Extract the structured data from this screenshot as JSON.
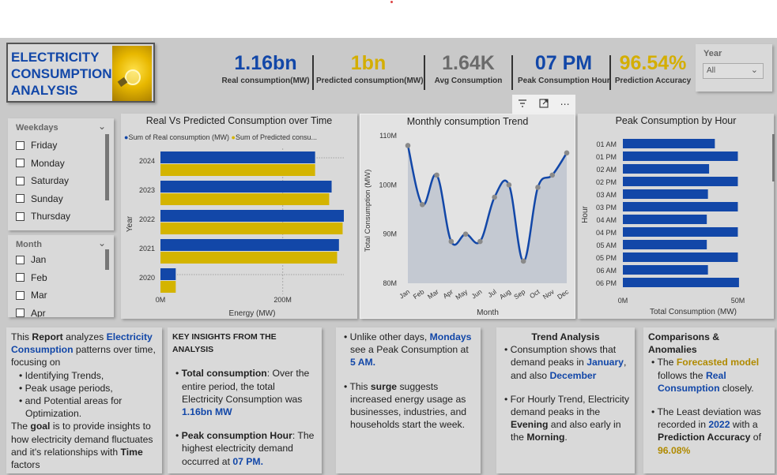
{
  "title": "ELECTRICITY CONSUMPTION ANALYSIS",
  "kpis": [
    {
      "value": "1.16bn",
      "label": "Real consumption(MW)",
      "color": "#1247a8"
    },
    {
      "value": "1bn",
      "label": "Predicted consumption(MW)",
      "color": "#d4ae00"
    },
    {
      "value": "1.64K",
      "label": "Avg Consumption",
      "color": "#6b6b6b"
    },
    {
      "value": "07 PM",
      "label": "Peak Consumption Hour",
      "color": "#1247a8"
    },
    {
      "value": "96.54%",
      "label": "Prediction Accuracy",
      "color": "#d4ae00"
    }
  ],
  "year_slicer": {
    "title": "Year",
    "value": "All"
  },
  "weekdays_slicer": {
    "title": "Weekdays",
    "items": [
      "Friday",
      "Monday",
      "Saturday",
      "Sunday",
      "Thursday"
    ]
  },
  "month_slicer": {
    "title": "Month",
    "items": [
      "Jan",
      "Feb",
      "Mar",
      "Apr"
    ]
  },
  "colors": {
    "real": "#1247a8",
    "predicted": "#d4b400",
    "area": "#c4c9d2"
  },
  "chart_data": [
    {
      "type": "bar",
      "title": "Real Vs Predicted Consumption over Time",
      "legend": [
        "Sum of Real consumption (MW)",
        "Sum of Predicted consu..."
      ],
      "xlabel": "Energy (MW)",
      "ylabel": "Year",
      "x_ticks": [
        "0M",
        "200M"
      ],
      "categories": [
        "2024",
        "2023",
        "2022",
        "2021",
        "2020"
      ],
      "xlim": [
        0,
        300
      ],
      "series": [
        {
          "name": "Sum of Real consumption (MW)",
          "values": [
            253,
            280,
            300,
            292,
            25
          ]
        },
        {
          "name": "Sum of Predicted consu...",
          "values": [
            253,
            276,
            298,
            289,
            25
          ]
        }
      ]
    },
    {
      "type": "line",
      "title": "Monthly consumption Trend",
      "xlabel": "Month",
      "ylabel": "Total Consumption (MW)",
      "y_ticks": [
        "80M",
        "90M",
        "100M",
        "110M"
      ],
      "ylim": [
        80,
        110
      ],
      "categories": [
        "Jan",
        "Feb",
        "Mar",
        "Apr",
        "May",
        "Jun",
        "Jul",
        "Aug",
        "Sep",
        "Oct",
        "Nov",
        "Dec"
      ],
      "values": [
        108,
        96,
        102,
        88.5,
        90,
        88.5,
        97.5,
        100,
        84.5,
        99.5,
        102,
        106.5
      ]
    },
    {
      "type": "bar",
      "title": "Peak Consumption by Hour",
      "xlabel": "Total Consumption (MW)",
      "ylabel": "Hour",
      "x_ticks": [
        "0M",
        "50M"
      ],
      "xlim": [
        0,
        55
      ],
      "categories": [
        "01 AM",
        "01 PM",
        "02 AM",
        "02 PM",
        "03 AM",
        "03 PM",
        "04 AM",
        "04 PM",
        "05 AM",
        "05 PM",
        "06 AM",
        "06 PM"
      ],
      "values": [
        40,
        50,
        37.5,
        50,
        37,
        50,
        36.5,
        50,
        36.5,
        50,
        37,
        50.5
      ]
    }
  ],
  "text_boxes": {
    "box1": {
      "p1": [
        "This ",
        "Report",
        " analyzes ",
        "Electricity Consumption",
        " patterns over time, focusing on"
      ],
      "bullets": [
        "Identifying Trends,",
        "Peak usage periods,",
        " and Potential areas for Optimization."
      ],
      "p2": [
        "The ",
        "goal",
        " is to provide insights to how electricity demand fluctuates and it's relationships with ",
        "Time",
        " factors"
      ]
    },
    "box2": {
      "heading": "KEY INSIGHTS FROM THE ANALYSIS",
      "b1": [
        "Total consumption",
        ": Over the entire period, the total Electricity Consumption was ",
        "1.16bn MW"
      ],
      "b2": [
        "Peak consumption Hour",
        ": The highest electricity demand occurred at ",
        "07 PM."
      ]
    },
    "box3": {
      "b1": [
        "Unlike other days, ",
        "Mondays",
        " see a Peak Consumption at ",
        "5 AM."
      ],
      "b2": [
        "This ",
        "surge",
        " suggests increased energy usage as businesses, industries, and households start the week."
      ]
    },
    "box4": {
      "heading": "Trend Analysis",
      "b1": [
        "Consumption shows that demand peaks in ",
        "January",
        ", and also ",
        "December"
      ],
      "b2": [
        "For Hourly Trend, Electricity demand peaks in the ",
        "Evening",
        " and also early in the ",
        "Morning",
        "."
      ]
    },
    "box5": {
      "heading": "Comparisons & Anomalies",
      "b1": [
        "The ",
        "Forecasted model",
        " follows the ",
        "Real Consumption",
        " closely."
      ],
      "b2": [
        "The Least deviation was recorded in ",
        "2022",
        " with a ",
        "Prediction Accuracy",
        " of ",
        "96.08%"
      ]
    }
  },
  "toolbar": {
    "filter": "filter-icon",
    "focus": "focus-mode-icon",
    "more": "more-options-icon"
  }
}
